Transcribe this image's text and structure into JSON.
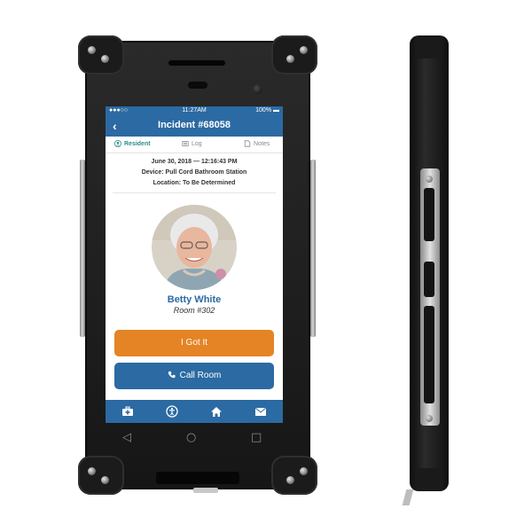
{
  "status_bar": {
    "signal": "●●●○○ ",
    "time": "11:27AM",
    "battery": "100% ▬"
  },
  "header": {
    "back": "‹",
    "title": "Incident #68058"
  },
  "tabs": [
    {
      "label": "Resident",
      "icon": "person-icon",
      "active": true
    },
    {
      "label": "Log",
      "icon": "log-icon",
      "active": false
    },
    {
      "label": "Notes",
      "icon": "notes-icon",
      "active": false
    }
  ],
  "incident": {
    "datetime": "June 30, 2018 — 12:16:43 PM",
    "device": "Device: Pull Cord Bathroom Station",
    "location": "Location: To Be Determined"
  },
  "resident": {
    "name": "Betty White",
    "room": "Room #302"
  },
  "actions": {
    "got_it": "I Got It",
    "call_room": "Call Room"
  },
  "bottom_nav": [
    "medical-kit-icon",
    "accessibility-icon",
    "home-icon",
    "mail-icon"
  ],
  "colors": {
    "primary": "#2b6aa3",
    "accent": "#e48424",
    "tab_active": "#2a8e8e"
  }
}
